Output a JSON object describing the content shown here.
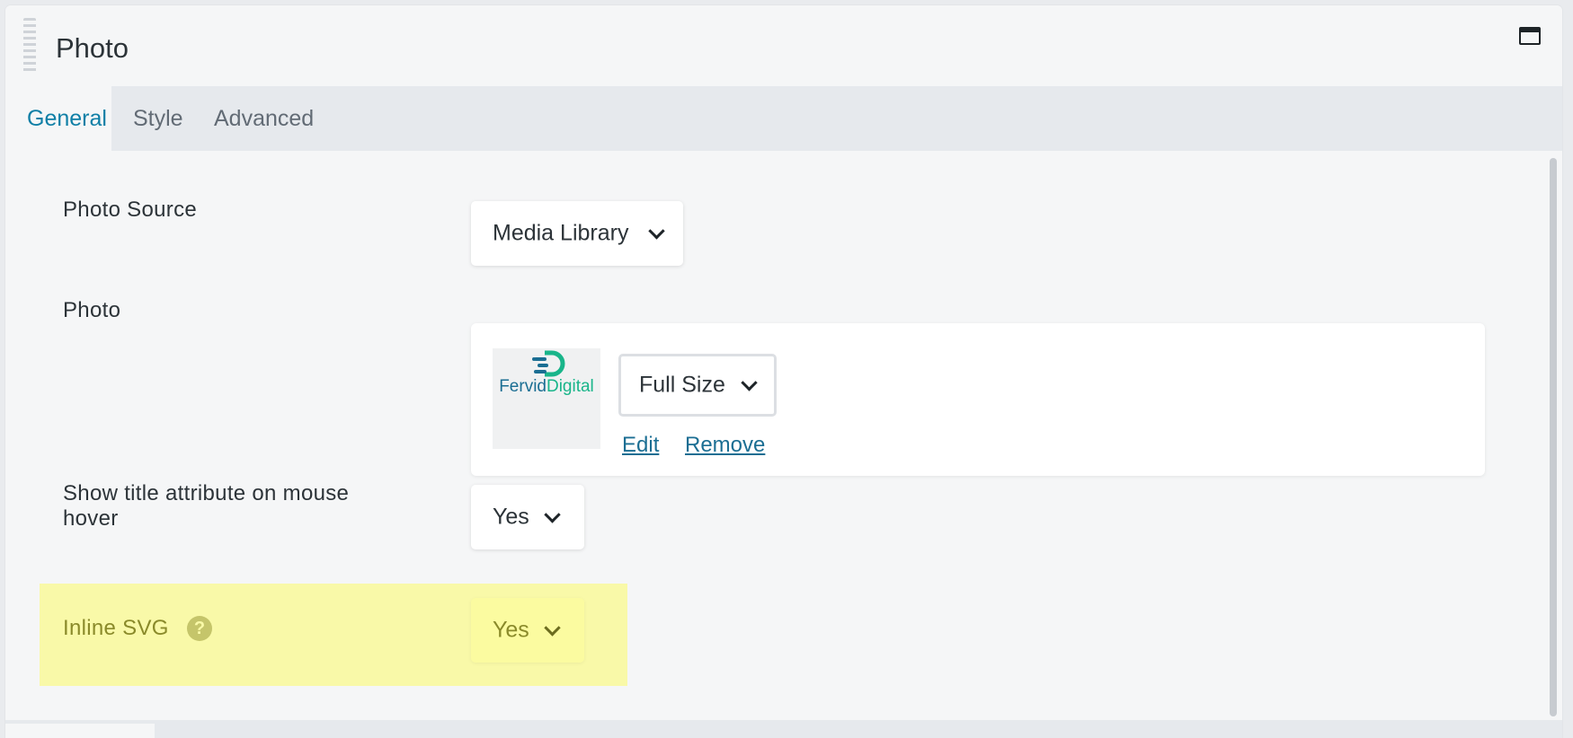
{
  "header": {
    "title": "Photo",
    "maximize_icon": "window-maximize-icon"
  },
  "tabs": [
    {
      "label": "General",
      "active": true
    },
    {
      "label": "Style",
      "active": false
    },
    {
      "label": "Advanced",
      "active": false
    }
  ],
  "fields": {
    "photo_source": {
      "label": "Photo Source",
      "value": "Media Library"
    },
    "photo": {
      "label": "Photo",
      "logo_text_a": "Fervid",
      "logo_text_b": "Digital",
      "size_value": "Full Size",
      "edit_label": "Edit",
      "remove_label": "Remove"
    },
    "show_title": {
      "label_line1": "Show title attribute on mouse",
      "label_line2": "hover",
      "value": "Yes"
    },
    "inline_svg": {
      "label": "Inline SVG",
      "value": "Yes",
      "help_icon": "question-mark-icon",
      "highlighted": true
    }
  },
  "colors": {
    "accent": "#0f7fa6",
    "highlight": "#f9f9a8",
    "link": "#1b6e93",
    "logo_teal": "#19b58a",
    "logo_blue": "#1b6e93"
  }
}
